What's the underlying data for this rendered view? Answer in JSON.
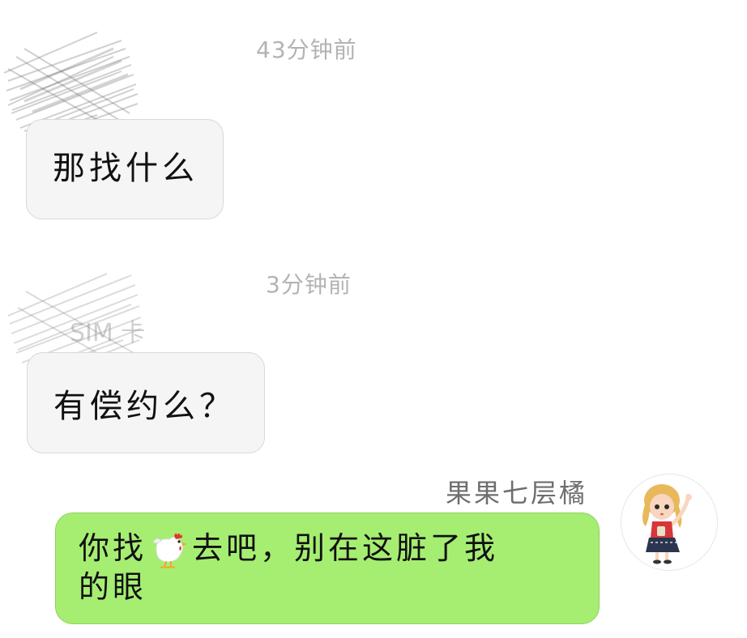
{
  "messages": [
    {
      "time": "43分钟前",
      "text": "那找什么"
    },
    {
      "time": "3分钟前",
      "text": "有偿约么？",
      "obscured_name": "SIM 卡"
    },
    {
      "sender": "果果七层橘",
      "text_before": "你找",
      "emoji_icon": "chicken-icon",
      "text_after": "去吧，别在这脏了我",
      "text_line2": "的眼"
    }
  ],
  "colors": {
    "incoming_bubble": "#f5f5f5",
    "outgoing_bubble": "#a6ee72",
    "timestamp": "#b3b3b3",
    "sender_name": "#6e6e6e"
  }
}
